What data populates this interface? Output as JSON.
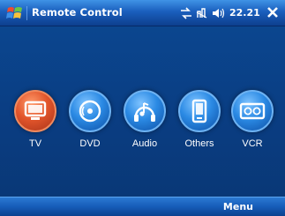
{
  "window": {
    "title": "Remote Control",
    "clock": "22.21"
  },
  "devices": [
    {
      "label": "TV",
      "icon": "tv-icon",
      "color": "#d9532e"
    },
    {
      "label": "DVD",
      "icon": "disc-icon",
      "color": "#1e7fd6"
    },
    {
      "label": "Audio",
      "icon": "music-note-icon",
      "color": "#1e7fd6"
    },
    {
      "label": "Others",
      "icon": "device-icon",
      "color": "#1e7fd6"
    },
    {
      "label": "VCR",
      "icon": "vcr-icon",
      "color": "#1e7fd6"
    }
  ],
  "menubar": {
    "menu_label": "Menu"
  },
  "colors": {
    "title_bar": "#1a5fbd",
    "background": "#0a3f86",
    "selected_accent": "#d9532e",
    "icon_blue": "#1e7fd6"
  }
}
